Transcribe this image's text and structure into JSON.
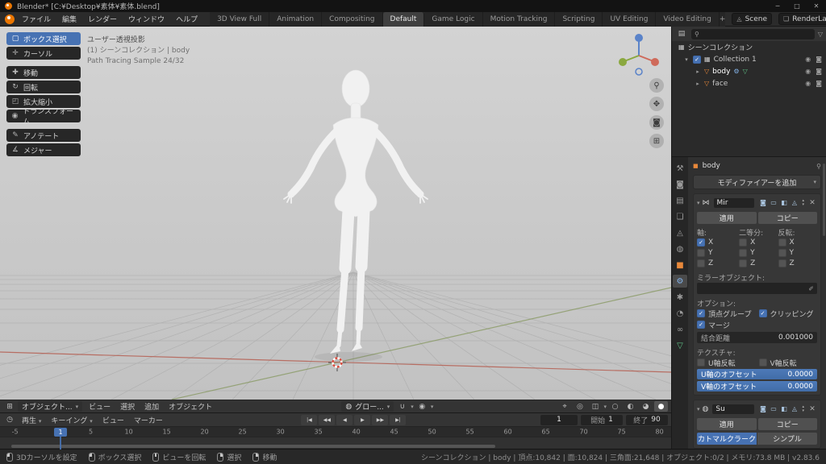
{
  "colors": {
    "accent": "#4772b3",
    "object_orange": "#e8883a",
    "mesh_green": "#5fc186",
    "modifier_blue": "#84b3e8",
    "axis_x_red": "#b55f52",
    "axis_y_green": "#85975e",
    "axis_z_blue": "#5a83c9",
    "viewport_bg": "#c8c8c8"
  },
  "icons": {
    "chevron_down": "▾",
    "caret_up": "▴",
    "caret_down": "▾",
    "close": "✕",
    "search": "⚲",
    "filter_funnel": "▽",
    "editor_3d_view": "⊞",
    "editor_outliner": "▤",
    "editor_timeline": "◷",
    "magnet": "∪",
    "orientation_globe": "◍",
    "falloff": "◉",
    "gizmo_pointer": "⌖",
    "overlays": "◎",
    "xray": "◫",
    "eye": "◉",
    "camera": "◙",
    "pin": "⚲",
    "eyedropper": "✐",
    "mirror_modifier": "⋈",
    "subsurf_modifier": "◍",
    "collection": "▦",
    "mesh": "▽",
    "wrench": "⚙",
    "mesh_data": "▽",
    "object_square": "■",
    "scene": "◬",
    "view_layer": "❏",
    "expand_right": "▸",
    "expand_down": "▾",
    "shading_wireframe": "○",
    "shading_solid": "◐",
    "shading_material": "◕",
    "shading_rendered": "●"
  },
  "titlebar": {
    "title": "Blender* [C:¥Desktop¥素体¥素体.blend]",
    "minimize": "─",
    "maximize": "□",
    "close": "✕"
  },
  "topbar": {
    "menus": [
      {
        "name": "file",
        "label": "ファイル"
      },
      {
        "name": "edit",
        "label": "編集"
      },
      {
        "name": "render",
        "label": "レンダー"
      },
      {
        "name": "window",
        "label": "ウィンドウ"
      },
      {
        "name": "help",
        "label": "ヘルプ"
      }
    ],
    "tabs": [
      {
        "name": "3d-view-full",
        "label": "3D View Full"
      },
      {
        "name": "animation",
        "label": "Animation"
      },
      {
        "name": "compositing",
        "label": "Compositing"
      },
      {
        "name": "default",
        "label": "Default",
        "active": true
      },
      {
        "name": "game-logic",
        "label": "Game Logic"
      },
      {
        "name": "motion-tracking",
        "label": "Motion Tracking"
      },
      {
        "name": "scripting",
        "label": "Scripting"
      },
      {
        "name": "uv-editing",
        "label": "UV Editing"
      },
      {
        "name": "video-editing",
        "label": "Video Editing"
      }
    ],
    "add_tab": "+",
    "scene_label": "Scene",
    "view_layer_label": "RenderLayer"
  },
  "tool_shelf": {
    "tools": [
      {
        "name": "box-select",
        "glyph": "▢",
        "label": "ボックス選択",
        "active": true
      },
      {
        "name": "cursor",
        "glyph": "✛",
        "label": "カーソル"
      },
      {
        "name": "move",
        "glyph": "✚",
        "label": "移動",
        "group": true
      },
      {
        "name": "rotate",
        "glyph": "↻",
        "label": "回転"
      },
      {
        "name": "scale",
        "glyph": "◰",
        "label": "拡大縮小"
      },
      {
        "name": "transform",
        "glyph": "◉",
        "label": "トランスフォーム"
      },
      {
        "name": "annotate",
        "glyph": "✎",
        "label": "アノテート",
        "group": true
      },
      {
        "name": "measure",
        "glyph": "∡",
        "label": "メジャー"
      }
    ]
  },
  "viewport": {
    "overlay": {
      "view_name": "ユーザー透視投影",
      "context": "(1) シーンコレクション | body",
      "render_status": "Path Tracing Sample 24/32"
    },
    "nav_buttons": [
      {
        "name": "zoom",
        "glyph": "⚲"
      },
      {
        "name": "pan",
        "glyph": "✥"
      },
      {
        "name": "camera-view",
        "glyph": "◙"
      },
      {
        "name": "toggle-perspective",
        "glyph": "⊞"
      }
    ],
    "header": {
      "mode": "オブジェクト...",
      "menus": [
        {
          "name": "view",
          "label": "ビュー"
        },
        {
          "name": "select",
          "label": "選択"
        },
        {
          "name": "add",
          "label": "追加"
        },
        {
          "name": "object",
          "label": "オブジェクト"
        }
      ],
      "orientation": "グロー...",
      "shading_active": "rendered"
    }
  },
  "outliner": {
    "search_value": "",
    "collection_checked": true,
    "rows": {
      "scene_collection": "シーンコレクション",
      "collection": "Collection 1",
      "body": "body",
      "face": "face"
    }
  },
  "properties": {
    "tabs": [
      {
        "name": "tool",
        "glyph": "⚒"
      },
      {
        "name": "render",
        "glyph": "◙"
      },
      {
        "name": "output",
        "glyph": "▤"
      },
      {
        "name": "view-layer",
        "glyph": "❏"
      },
      {
        "name": "scene",
        "glyph": "◬"
      },
      {
        "name": "world",
        "glyph": "◍"
      },
      {
        "name": "object",
        "glyph": "■",
        "cls": "c-orange"
      },
      {
        "name": "modifiers",
        "glyph": "⚙",
        "cls": "c-blue",
        "active": true
      },
      {
        "name": "particles",
        "glyph": "✱"
      },
      {
        "name": "physics",
        "glyph": "◔"
      },
      {
        "name": "constraints",
        "glyph": "∞"
      },
      {
        "name": "object-data",
        "glyph": "▽",
        "cls": "c-green"
      }
    ],
    "breadcrumb": "body",
    "add_modifier": "モディファイアーを追加",
    "modifier_toggles": [
      {
        "name": "render-toggle",
        "glyph": "◙"
      },
      {
        "name": "realtime-toggle",
        "glyph": "▭"
      },
      {
        "name": "editmode-toggle",
        "glyph": "◧"
      },
      {
        "name": "cage-toggle",
        "glyph": "◬"
      }
    ],
    "mirror": {
      "name": "Mir",
      "apply": "適用",
      "copy": "コピー",
      "axis_label": "軸:",
      "bisect_label": "二等分:",
      "flip_label": "反転:",
      "axis_labels": [
        "X",
        "Y",
        "Z"
      ],
      "axis": {
        "x": true,
        "y": false,
        "z": false
      },
      "bisect": {
        "x": false,
        "y": false,
        "z": false
      },
      "flip": {
        "x": false,
        "y": false,
        "z": false
      },
      "mirror_object_label": "ミラーオブジェクト:",
      "options_label": "オプション:",
      "vertex_groups_label": "頂点グループ",
      "vertex_groups": true,
      "clipping_label": "クリッピング",
      "clipping": true,
      "merge_label": "マージ",
      "merge": true,
      "merge_distance_label": "結合距離",
      "merge_distance_value": "0.001000",
      "textures_label": "テクスチャ:",
      "flip_u_label": "U軸反転",
      "flip_u": false,
      "flip_v_label": "V軸反転",
      "flip_v": false,
      "offset_u_label": "U軸のオフセット",
      "offset_u_value": "0.0000",
      "offset_v_label": "V軸のオフセット",
      "offset_v_value": "0.0000"
    },
    "subsurf": {
      "name": "Su",
      "apply": "適用",
      "copy": "コピー",
      "catmull_label": "カトマルクラーク",
      "simple_label": "シンプル"
    }
  },
  "timeline": {
    "menus": {
      "playback": "再生",
      "keying": "キーイング",
      "view": "ビュー",
      "marker": "マーカー"
    },
    "transport": [
      {
        "name": "jump-to-start",
        "glyph": "|◀"
      },
      {
        "name": "prev-keyframe",
        "glyph": "◀◀"
      },
      {
        "name": "play-reverse",
        "glyph": "◀"
      },
      {
        "name": "play",
        "glyph": "▶"
      },
      {
        "name": "next-keyframe",
        "glyph": "▶▶"
      },
      {
        "name": "jump-to-end",
        "glyph": "▶|"
      }
    ],
    "current_frame": "1",
    "start_label": "開始",
    "start_value": "1",
    "end_label": "終了",
    "end_value": "90",
    "ruler_frames": [
      -5,
      5,
      10,
      15,
      20,
      25,
      30,
      35,
      40,
      45,
      50,
      55,
      60,
      65,
      70,
      75,
      80
    ]
  },
  "statusbar": {
    "hints": [
      {
        "name": "set-3d-cursor",
        "variant": "left",
        "label": "3Dカーソルを設定"
      },
      {
        "name": "box-select",
        "variant": "left",
        "label": "ボックス選択"
      },
      {
        "name": "rotate-view",
        "variant": "middle",
        "label": "ビューを回転"
      },
      {
        "name": "select",
        "variant": "right",
        "label": "選択"
      },
      {
        "name": "move",
        "variant": "right",
        "label": "移動"
      }
    ],
    "stats": "シーンコレクション | body | 頂点:10,842 | 面:10,824 | 三角面:21,648 | オブジェクト:0/2 | メモリ:73.8 MB | v2.83.6"
  }
}
